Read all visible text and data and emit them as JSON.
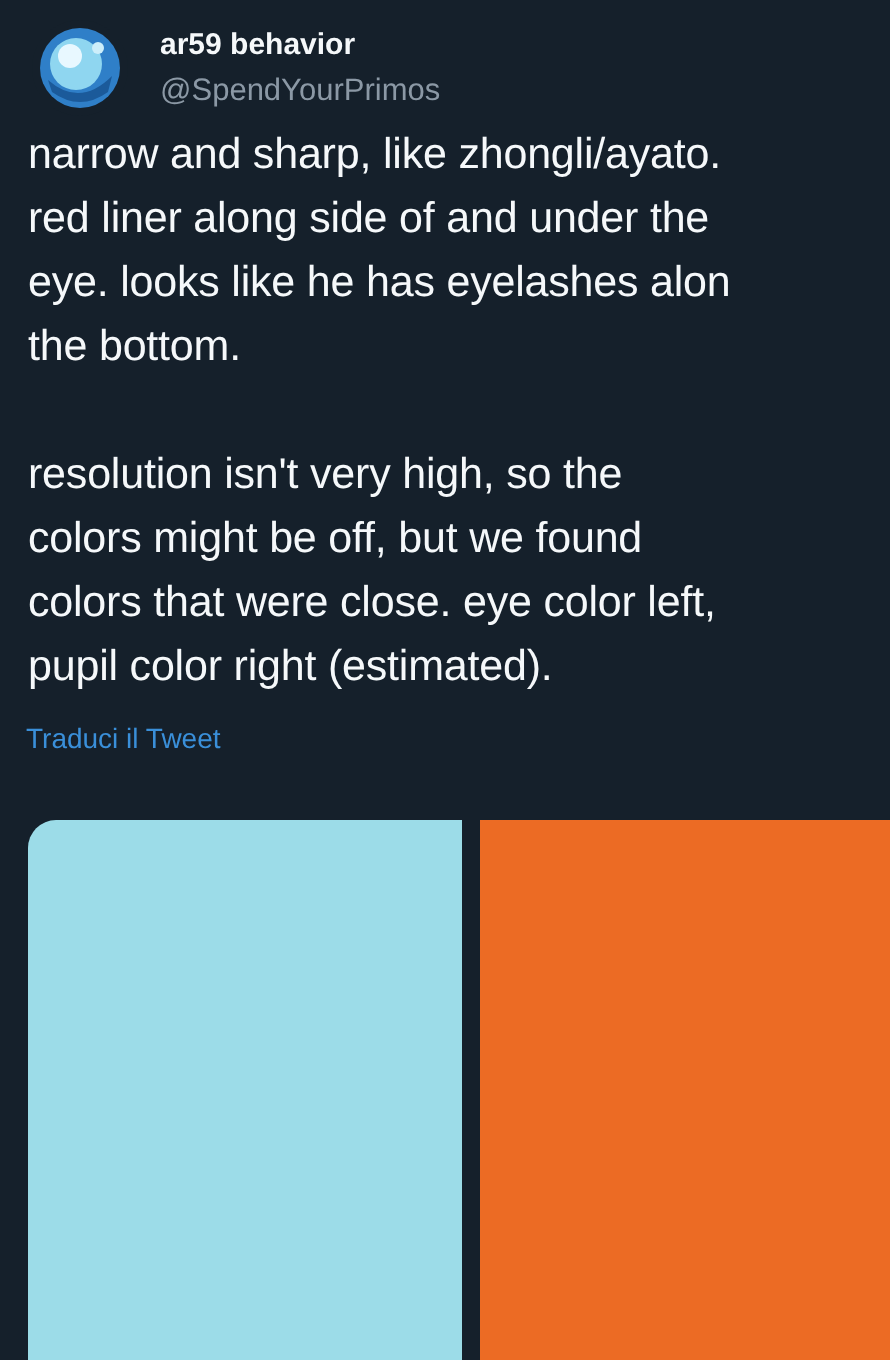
{
  "author": {
    "name": "ar59 behavior",
    "handle": "@SpendYourPrimos"
  },
  "body": [
    "narrow and sharp, like zhongli/ayato.\nred liner along side of and under the\neye. looks like he has eyelashes alon\nthe bottom.",
    "resolution isn't very high, so the\ncolors might be off, but we found\ncolors that were close. eye color left,\npupil color right (estimated)."
  ],
  "translate_link": "Traduci il Tweet",
  "media": [
    {
      "kind": "swatch",
      "color": "#9cdce8"
    },
    {
      "kind": "swatch",
      "color": "#ec6b24"
    }
  ]
}
